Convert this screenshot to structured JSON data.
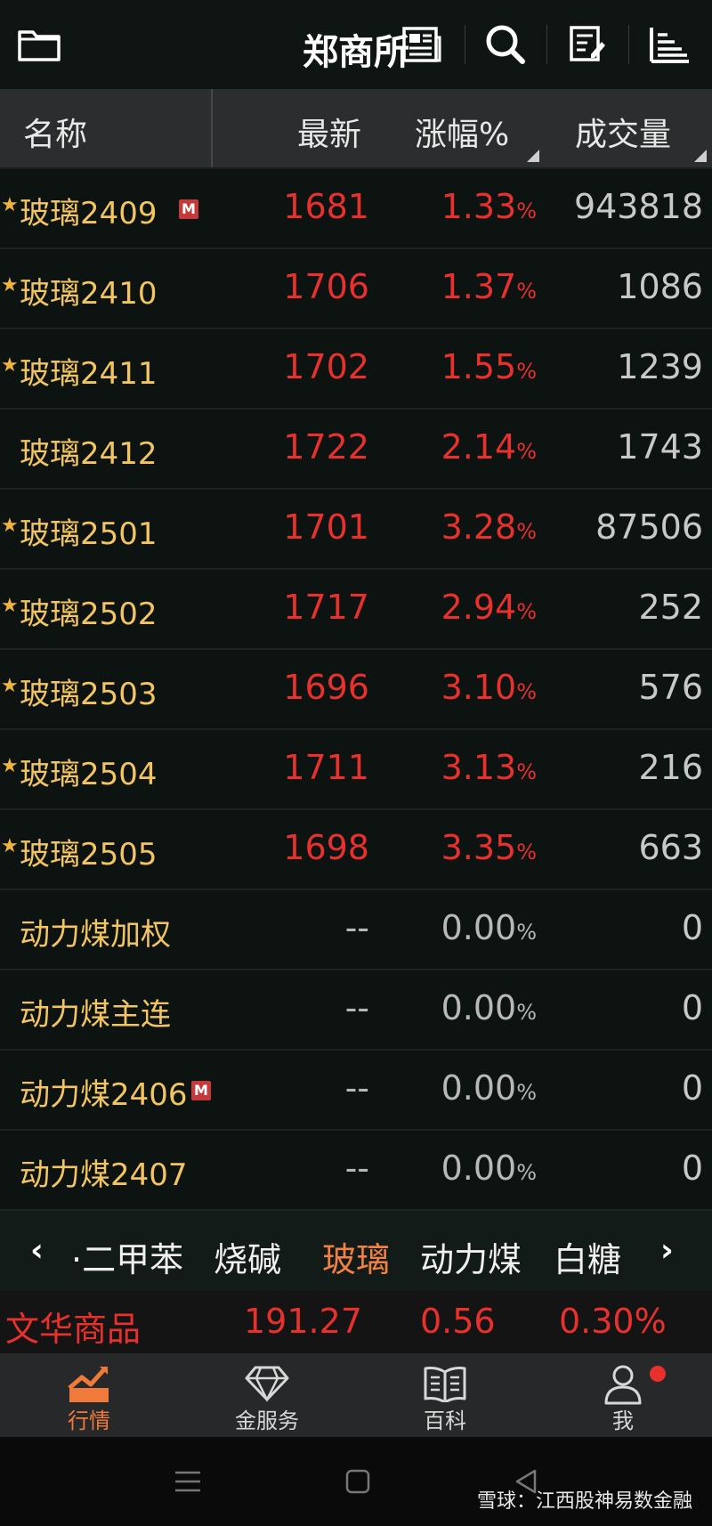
{
  "app": {
    "title": "郑商所",
    "icons": [
      "folder-icon",
      "news-icon",
      "search-icon",
      "edit-list-icon",
      "sort-bars-icon"
    ]
  },
  "columns": {
    "name": "名称",
    "latest": "最新",
    "change": "涨幅%",
    "volume": "成交量"
  },
  "rows": [
    {
      "starred": true,
      "name": "玻璃2409",
      "badge": "M",
      "price": "1681",
      "change": "1.33",
      "volume": "943818"
    },
    {
      "starred": true,
      "name": "玻璃2410",
      "badge": "",
      "price": "1706",
      "change": "1.37",
      "volume": "1086"
    },
    {
      "starred": true,
      "name": "玻璃2411",
      "badge": "",
      "price": "1702",
      "change": "1.55",
      "volume": "1239"
    },
    {
      "starred": false,
      "name": "玻璃2412",
      "badge": "",
      "price": "1722",
      "change": "2.14",
      "volume": "1743"
    },
    {
      "starred": true,
      "name": "玻璃2501",
      "badge": "",
      "price": "1701",
      "change": "3.28",
      "volume": "87506"
    },
    {
      "starred": true,
      "name": "玻璃2502",
      "badge": "",
      "price": "1717",
      "change": "2.94",
      "volume": "252"
    },
    {
      "starred": true,
      "name": "玻璃2503",
      "badge": "",
      "price": "1696",
      "change": "3.10",
      "volume": "576"
    },
    {
      "starred": true,
      "name": "玻璃2504",
      "badge": "",
      "price": "1711",
      "change": "3.13",
      "volume": "216"
    },
    {
      "starred": true,
      "name": "玻璃2505",
      "badge": "",
      "price": "1698",
      "change": "3.35",
      "volume": "663"
    },
    {
      "starred": false,
      "name": "动力煤加权",
      "badge": "",
      "price": "--",
      "change": "0.00",
      "volume": "0"
    },
    {
      "starred": false,
      "name": "动力煤主连",
      "badge": "",
      "price": "--",
      "change": "0.00",
      "volume": "0"
    },
    {
      "starred": false,
      "name": "动力煤2406",
      "badge": "M",
      "price": "--",
      "change": "0.00",
      "volume": "0"
    },
    {
      "starred": false,
      "name": "动力煤2407",
      "badge": "",
      "price": "--",
      "change": "0.00",
      "volume": "0"
    }
  ],
  "pct_symbol": "%",
  "categories": {
    "items": [
      "·二甲苯",
      "烧碱",
      "玻璃",
      "动力煤",
      "白糖"
    ],
    "active": "玻璃",
    "prev": "‹",
    "next": "›"
  },
  "index": {
    "name": "文华商品",
    "value": "191.27",
    "change": "0.56",
    "change_pct": "0.30%"
  },
  "nav": {
    "tabs": [
      {
        "label": "行情",
        "icon": "market-chart-icon",
        "active": true
      },
      {
        "label": "金服务",
        "icon": "diamond-icon",
        "active": false
      },
      {
        "label": "百科",
        "icon": "book-icon",
        "active": false
      },
      {
        "label": "我",
        "icon": "user-icon",
        "active": false,
        "notification": true
      }
    ]
  },
  "watermark": "雪球：江西股神易数金融",
  "colors": {
    "up": "#e8302c",
    "name": "#f2c562",
    "active_tab": "#f07a3a",
    "background": "#0c1311"
  }
}
